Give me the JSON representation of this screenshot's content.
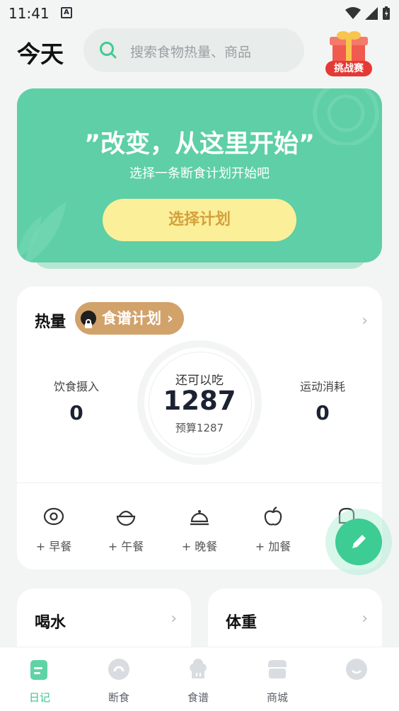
{
  "status": {
    "time": "11:41",
    "notification": "A"
  },
  "header": {
    "title": "今天",
    "search_placeholder": "搜索食物热量、商品",
    "challenge_label": "挑战赛"
  },
  "banner": {
    "title": "”改变，从这里开始”",
    "subtitle": "选择一条断食计划开始吧",
    "button": "选择计划"
  },
  "calories": {
    "title": "热量",
    "recipe_plan": "食谱计划",
    "intake_label": "饮食摄入",
    "intake_value": "0",
    "remaining_label": "还可以吃",
    "remaining_value": "1287",
    "budget": "预算1287",
    "burn_label": "运动消耗",
    "burn_value": "0"
  },
  "meals": [
    {
      "label": "+ 早餐",
      "icon": "egg-icon"
    },
    {
      "label": "+ 午餐",
      "icon": "rice-bowl-icon"
    },
    {
      "label": "+ 晚餐",
      "icon": "cloche-icon"
    },
    {
      "label": "+ 加餐",
      "icon": "apple-icon"
    },
    {
      "label": "+",
      "icon": "bread-icon"
    }
  ],
  "cards": {
    "water": "喝水",
    "weight": "体重"
  },
  "tabs": [
    {
      "label": "日记",
      "icon": "diary-icon",
      "active": true
    },
    {
      "label": "断食",
      "icon": "fasting-icon",
      "active": false
    },
    {
      "label": "食谱",
      "icon": "chef-hat-icon",
      "active": false
    },
    {
      "label": "商城",
      "icon": "store-icon",
      "active": false
    },
    {
      "label": "",
      "icon": "profile-icon",
      "active": false
    }
  ],
  "colors": {
    "accent": "#3dcc93",
    "banner": "#5ecfa6",
    "plan_button": "#fbef9a",
    "recipe_pill": "#d2a26b",
    "challenge": "#e53935"
  }
}
